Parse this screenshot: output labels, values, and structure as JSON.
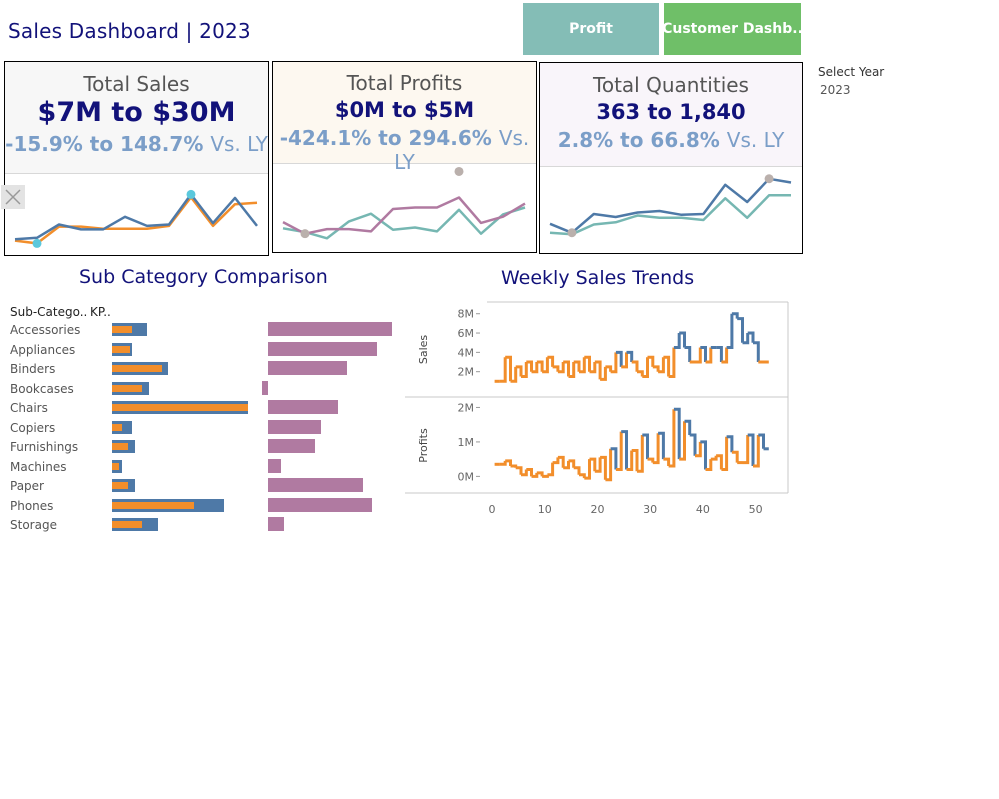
{
  "header": {
    "title": "Sales Dashboard | 2023",
    "nav_profit": "Profit",
    "nav_customer": "Customer Dashb..",
    "profit_color": "#84bdb6",
    "customer_color": "#6fbf68"
  },
  "filter": {
    "label": "Select Year",
    "value": "2023"
  },
  "kpis": [
    {
      "label": "Total Sales",
      "value": "$7M to $30M",
      "change": "-15.9% to 148.7%",
      "ly": "Vs. LY",
      "bg": "#f7f7f7",
      "cy_color": "#4e79a7",
      "py_color": "#f28e2b",
      "marker_color": "#5bc8dc",
      "cy": [
        0.14,
        0.16,
        0.35,
        0.28,
        0.28,
        0.46,
        0.33,
        0.35,
        0.78,
        0.37,
        0.73,
        0.33
      ],
      "py": [
        0.12,
        0.08,
        0.32,
        0.32,
        0.29,
        0.29,
        0.29,
        0.33,
        0.74,
        0.33,
        0.64,
        0.66
      ]
    },
    {
      "label": "Total Profits",
      "value": "$0M to $5M",
      "change": "-424.1% to 294.6%",
      "ly": "Vs. LY",
      "bg": "#fdf8f0",
      "cy_color": "#b07aa1",
      "py_color": "#76b7b2",
      "marker_color": "#bab0ac",
      "cy": [
        0.31,
        0.16,
        0.22,
        0.22,
        0.19,
        0.48,
        0.5,
        0.5,
        0.63,
        0.3,
        0.38,
        0.55
      ],
      "py": [
        0.23,
        0.18,
        0.1,
        0.32,
        0.42,
        0.21,
        0.24,
        0.19,
        0.47,
        0.16,
        0.41,
        0.5
      ]
    },
    {
      "label": "Total Quantities",
      "value": "363 to 1,840",
      "change": "2.8% to 66.8%",
      "ly": "Vs. LY",
      "bg": "#f9f5fa",
      "cy_color": "#4e79a7",
      "py_color": "#76b7b2",
      "marker_color": "#bab0ac",
      "cy": [
        0.31,
        0.19,
        0.44,
        0.4,
        0.46,
        0.48,
        0.43,
        0.44,
        0.83,
        0.6,
        0.91,
        0.86
      ],
      "py": [
        0.19,
        0.17,
        0.3,
        0.33,
        0.42,
        0.39,
        0.39,
        0.36,
        0.65,
        0.39,
        0.69,
        0.69
      ]
    }
  ],
  "subcategory": {
    "title": "Sub Category Comparison",
    "col_subcat": "Sub-Catego..",
    "col_kpi": "KP..",
    "rows": [
      {
        "name": "Accessories",
        "sales_cy": 0.26,
        "sales_py": 0.15,
        "profit": 0.95
      },
      {
        "name": "Appliances",
        "sales_cy": 0.15,
        "sales_py": 0.13,
        "profit": 0.84
      },
      {
        "name": "Binders",
        "sales_cy": 0.41,
        "sales_py": 0.37,
        "profit": 0.61
      },
      {
        "name": "Bookcases",
        "sales_cy": 0.27,
        "sales_py": 0.22,
        "profit": -0.05
      },
      {
        "name": "Chairs",
        "sales_cy": 1.0,
        "sales_py": 1.0,
        "profit": 0.54
      },
      {
        "name": "Copiers",
        "sales_cy": 0.15,
        "sales_py": 0.07,
        "profit": 0.41
      },
      {
        "name": "Furnishings",
        "sales_cy": 0.17,
        "sales_py": 0.12,
        "profit": 0.36
      },
      {
        "name": "Machines",
        "sales_cy": 0.07,
        "sales_py": 0.05,
        "profit": 0.1
      },
      {
        "name": "Paper",
        "sales_cy": 0.17,
        "sales_py": 0.12,
        "profit": 0.73
      },
      {
        "name": "Phones",
        "sales_cy": 0.82,
        "sales_py": 0.6,
        "profit": 0.8
      },
      {
        "name": "Storage",
        "sales_cy": 0.34,
        "sales_py": 0.22,
        "profit": 0.12
      }
    ],
    "cy_color": "#4e79a7",
    "py_color": "#f28e2b",
    "profit_color": "#b07aa1"
  },
  "weekly": {
    "title": "Weekly Sales Trends",
    "xticks": [
      "0",
      "10",
      "20",
      "30",
      "40",
      "50"
    ],
    "sales_label": "Sales",
    "profits_label": "Profits",
    "sales_ticks": [
      "8M",
      "6M",
      "4M",
      "2M"
    ],
    "profit_ticks": [
      "2M",
      "1M",
      "0M"
    ],
    "high_color": "#4e79a7",
    "low_color": "#f28e2b",
    "sales_weeks": [
      1,
      2,
      3,
      4,
      5,
      6,
      7,
      8,
      9,
      10,
      11,
      12,
      13,
      14,
      15,
      16,
      17,
      18,
      19,
      20,
      21,
      22,
      23,
      24,
      25,
      26,
      27,
      28,
      29,
      30,
      31,
      32,
      33,
      34,
      35,
      36,
      37,
      38,
      39,
      40,
      41,
      42,
      43,
      44,
      45,
      46,
      47,
      48,
      49,
      50,
      51,
      52
    ],
    "sales_values": [
      1.0,
      1.0,
      3.5,
      1.0,
      2.5,
      1.5,
      3.0,
      2.0,
      3.0,
      2.0,
      3.5,
      2.5,
      2.0,
      3.0,
      1.5,
      3.0,
      2.0,
      3.5,
      2.0,
      3.0,
      1.2,
      2.5,
      2.0,
      4.0,
      2.5,
      4.0,
      3.0,
      2.0,
      1.5,
      3.5,
      2.5,
      2.0,
      3.5,
      1.5,
      4.5,
      6.0,
      4.5,
      3.0,
      3.0,
      4.5,
      3.0,
      4.5,
      4.5,
      3.0,
      4.5,
      8.0,
      7.5,
      5.0,
      6.0,
      5.0,
      3.0,
      3.0
    ],
    "profit_values": [
      0.35,
      0.35,
      0.45,
      0.3,
      0.25,
      0.05,
      0.2,
      0.0,
      0.1,
      0.0,
      0.05,
      0.4,
      0.55,
      0.25,
      0.45,
      0.25,
      0.05,
      -0.05,
      0.5,
      0.15,
      0.55,
      -0.1,
      0.8,
      0.2,
      1.3,
      0.2,
      0.75,
      0.15,
      1.2,
      0.5,
      0.4,
      1.25,
      0.5,
      0.3,
      1.95,
      0.5,
      1.6,
      1.2,
      0.6,
      1.0,
      0.2,
      0.5,
      0.6,
      0.2,
      1.15,
      0.7,
      0.4,
      0.4,
      1.2,
      0.3,
      1.2,
      0.8
    ],
    "sales_max": 8.8,
    "profit_min": -0.25,
    "profit_max": 2.1,
    "x_max": 55
  }
}
